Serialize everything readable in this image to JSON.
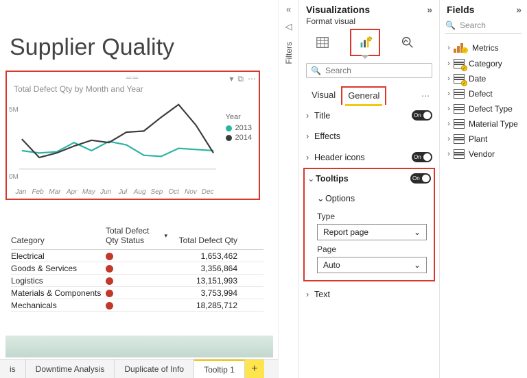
{
  "page_title": "Supplier Quality",
  "chart": {
    "title": "Total Defect Qty by Month and Year",
    "legend_title": "Year",
    "legend": [
      {
        "label": "2013",
        "color": "#2bb4a3"
      },
      {
        "label": "2014",
        "color": "#3b3b3b"
      }
    ],
    "y_ticks": [
      "5M",
      "0M"
    ],
    "x_ticks": [
      "Jan",
      "Feb",
      "Mar",
      "Apr",
      "May",
      "Jun",
      "Jul",
      "Aug",
      "Sep",
      "Oct",
      "Nov",
      "Dec"
    ]
  },
  "chart_data": {
    "type": "line",
    "xlabel": "",
    "ylabel": "",
    "ylim": [
      0,
      6000000
    ],
    "categories": [
      "Jan",
      "Feb",
      "Mar",
      "Apr",
      "May",
      "Jun",
      "Jul",
      "Aug",
      "Sep",
      "Oct",
      "Nov",
      "Dec"
    ],
    "series": [
      {
        "name": "2013",
        "color": "#2bb4a3",
        "values": [
          1600000,
          1400000,
          1500000,
          2300000,
          1600000,
          2400000,
          2100000,
          1200000,
          1100000,
          1800000,
          1700000,
          1600000
        ]
      },
      {
        "name": "2014",
        "color": "#3b3b3b",
        "values": [
          2600000,
          1000000,
          1400000,
          2000000,
          2500000,
          2300000,
          3200000,
          3300000,
          4500000,
          5600000,
          3800000,
          1400000
        ]
      }
    ]
  },
  "table": {
    "headers": {
      "c1": "Category",
      "c2": "Total Defect Qty Status",
      "c3": "Total Defect Qty"
    },
    "rows": [
      {
        "c1": "Electrical",
        "c3": "1,653,462"
      },
      {
        "c1": "Goods & Services",
        "c3": "3,356,864"
      },
      {
        "c1": "Logistics",
        "c3": "13,151,993"
      },
      {
        "c1": "Materials & Components",
        "c3": "3,753,994"
      },
      {
        "c1": "Mechanicals",
        "c3": "18,285,712"
      }
    ]
  },
  "page_tabs": {
    "t0": "is",
    "t1": "Downtime Analysis",
    "t2": "Duplicate of Info",
    "t3": "Tooltip 1"
  },
  "filters_label": "Filters",
  "viz": {
    "header": "Visualizations",
    "sub": "Format visual",
    "search_placeholder": "Search",
    "tabs": {
      "visual": "Visual",
      "general": "General"
    },
    "sections": {
      "title": "Title",
      "effects": "Effects",
      "headericons": "Header icons",
      "tooltips": "Tooltips",
      "text": "Text"
    },
    "toggle_on": "On",
    "tooltips": {
      "options": "Options",
      "type_label": "Type",
      "type_value": "Report page",
      "page_label": "Page",
      "page_value": "Auto"
    }
  },
  "fields": {
    "header": "Fields",
    "search_placeholder": "Search",
    "items": [
      {
        "label": "Metrics",
        "kind": "measure",
        "checked": true
      },
      {
        "label": "Category",
        "kind": "table",
        "checked": true
      },
      {
        "label": "Date",
        "kind": "table",
        "checked": true
      },
      {
        "label": "Defect",
        "kind": "table",
        "checked": false
      },
      {
        "label": "Defect Type",
        "kind": "table",
        "checked": false
      },
      {
        "label": "Material Type",
        "kind": "table",
        "checked": false
      },
      {
        "label": "Plant",
        "kind": "table",
        "checked": false
      },
      {
        "label": "Vendor",
        "kind": "table",
        "checked": false
      }
    ]
  }
}
